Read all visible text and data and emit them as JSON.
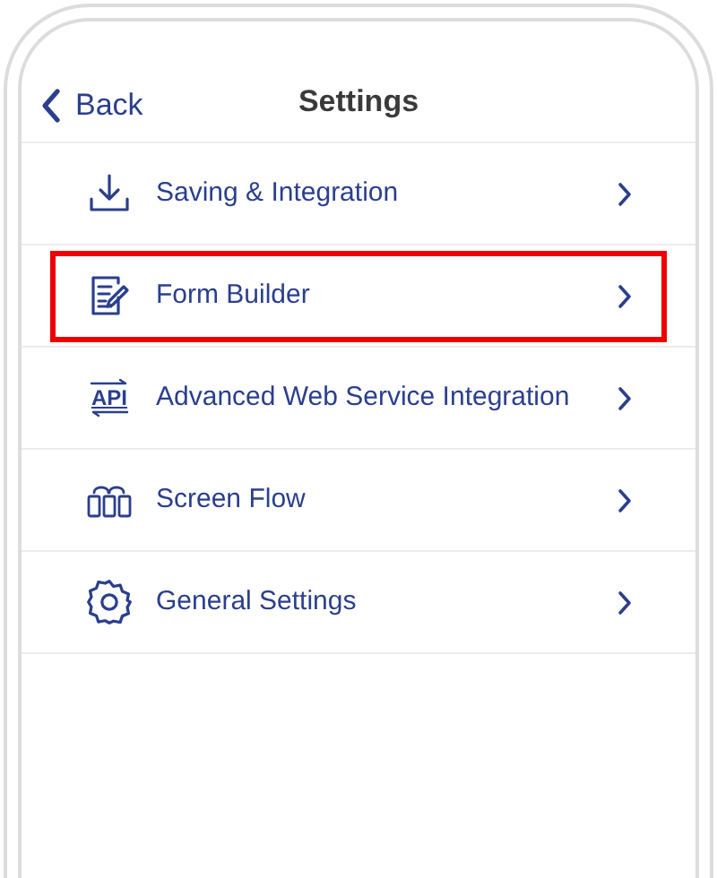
{
  "header": {
    "back": "Back",
    "title": "Settings"
  },
  "items": [
    {
      "kind": "download",
      "label": "Saving & Integration",
      "highlighted": false
    },
    {
      "kind": "form",
      "label": "Form Builder",
      "highlighted": true
    },
    {
      "kind": "api",
      "icon_text": "API",
      "label": "Advanced Web Service Integration",
      "highlighted": false
    },
    {
      "kind": "flow",
      "label": "Screen Flow",
      "highlighted": false
    },
    {
      "kind": "gear",
      "label": "General Settings",
      "highlighted": false
    }
  ]
}
